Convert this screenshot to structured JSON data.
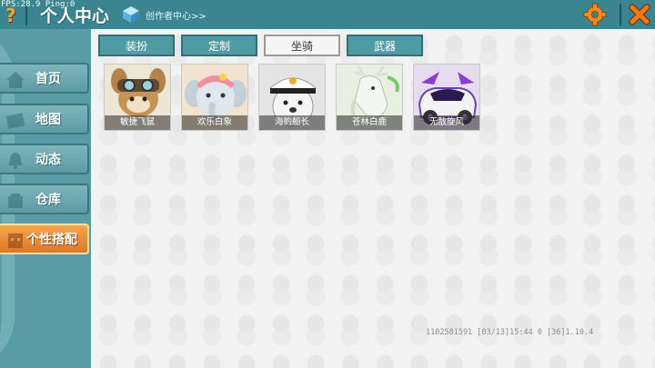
{
  "header": {
    "fps": "FPS:28.9  Ping:0",
    "title": "个人中心",
    "creator_center": "创作者中心>>"
  },
  "sidebar": {
    "items": [
      {
        "label": "首页",
        "icon": "home-icon"
      },
      {
        "label": "地图",
        "icon": "map-icon"
      },
      {
        "label": "动态",
        "icon": "bell-icon"
      },
      {
        "label": "仓库",
        "icon": "package-icon"
      },
      {
        "label": "个性搭配",
        "icon": "avatar-icon",
        "active": true
      }
    ]
  },
  "tabs": [
    {
      "label": "装扮"
    },
    {
      "label": "定制"
    },
    {
      "label": "坐骑",
      "active": true
    },
    {
      "label": "武器"
    }
  ],
  "mounts": [
    {
      "name": "敏捷飞鼠",
      "bg": "#ece6d4"
    },
    {
      "name": "欢乐白象",
      "bg": "#f1e3cd"
    },
    {
      "name": "海豹船长",
      "bg": "#e4e4e4"
    },
    {
      "name": "苍林白鹿",
      "bg": "#e8f0e2"
    },
    {
      "name": "无敌旋风",
      "bg": "#e6dcf0"
    }
  ],
  "footer": {
    "info": "1102581591  [03/13]15:44 0  [36]1.10.4"
  },
  "colors": {
    "accent": "#e0762a",
    "teal": "#3a8590"
  }
}
